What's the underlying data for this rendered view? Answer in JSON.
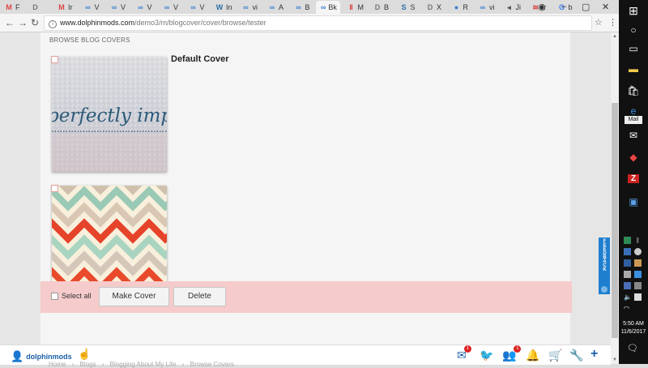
{
  "tabs": [
    {
      "icon": "M",
      "label": "F",
      "color": "#d44"
    },
    {
      "icon": "D",
      "label": "",
      "color": "#777"
    },
    {
      "icon": "M",
      "label": "Ir",
      "color": "#d44"
    },
    {
      "icon": "∞",
      "label": "V",
      "color": "#3a7fd0"
    },
    {
      "icon": "∞",
      "label": "V",
      "color": "#3a7fd0"
    },
    {
      "icon": "∞",
      "label": "V",
      "color": "#3a7fd0"
    },
    {
      "icon": "∞",
      "label": "V",
      "color": "#3a7fd0"
    },
    {
      "icon": "∞",
      "label": "V",
      "color": "#3a7fd0"
    },
    {
      "icon": "W",
      "label": "In",
      "color": "#2a6fa8"
    },
    {
      "icon": "∞",
      "label": "vi",
      "color": "#3a7fd0"
    },
    {
      "icon": "∞",
      "label": "A",
      "color": "#3a7fd0"
    },
    {
      "icon": "∞",
      "label": "B",
      "color": "#3a7fd0"
    },
    {
      "icon": "∞",
      "label": "Bk",
      "color": "#3a7fd0",
      "active": true
    },
    {
      "icon": "‖",
      "label": "M",
      "color": "#d22"
    },
    {
      "icon": "D",
      "label": "B",
      "color": "#777"
    },
    {
      "icon": "S",
      "label": "S",
      "color": "#2a6fa8"
    },
    {
      "icon": "D",
      "label": "X",
      "color": "#777"
    },
    {
      "icon": "●",
      "label": "R",
      "color": "#3a7fd0"
    },
    {
      "icon": "∞",
      "label": "vi",
      "color": "#3a7fd0"
    },
    {
      "icon": "◂",
      "label": "Ji",
      "color": "#555"
    },
    {
      "icon": "≋",
      "label": "Ir",
      "color": "#d44"
    },
    {
      "icon": "G",
      "label": "b",
      "color": "#4285f4"
    }
  ],
  "address": {
    "host": "www.dolphinmods.com",
    "path": "/demo3/m/blogcover/cover/browse/tester"
  },
  "page": {
    "section_title": "BROWSE BLOG COVERS",
    "default_cover_label": "Default Cover",
    "cover1_script_text": "perfectly imperfect",
    "select_all": "Select all",
    "make_cover": "Make Cover",
    "delete": "Delete",
    "feedback": "FEEDBACK"
  },
  "sitebar": {
    "username": "dolphinmods",
    "breadcrumb": [
      "Home",
      "Blogs",
      "Blogging About My Life",
      "Browse Covers"
    ],
    "messages_badge": "1",
    "friends_badge": "1"
  },
  "taskbar": {
    "mail_tooltip": "Mail",
    "time": "5:50 AM",
    "date": "11/6/2017"
  },
  "colors": {
    "accent": "#1c5fa8",
    "bottom_bar": "#f5cbcb",
    "feedback": "#1f7fcf"
  }
}
